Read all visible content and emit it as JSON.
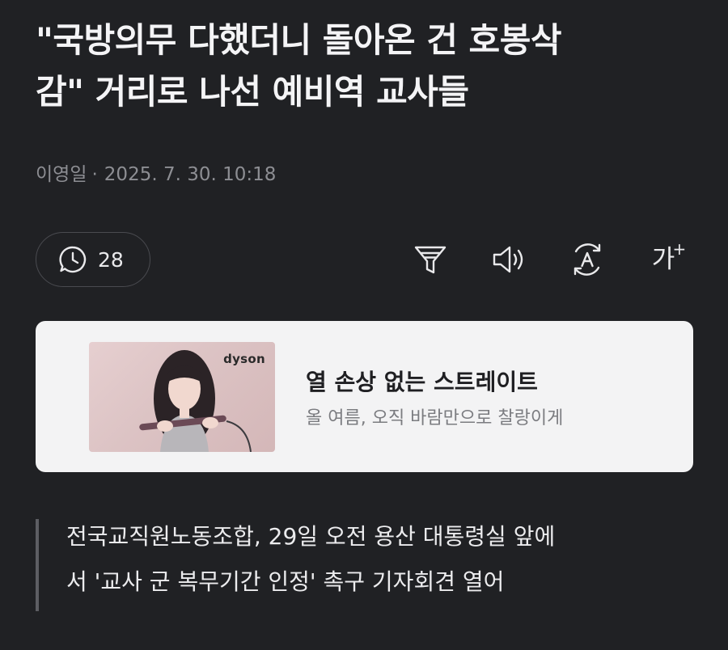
{
  "article": {
    "headline_line1": "\"국방의무 다했더니 돌아온 건 호봉삭",
    "headline_line2": "감\" 거리로 나선 예비역 교사들",
    "author": "이영일",
    "separator": "·",
    "datetime": "2025. 7. 30. 10:18",
    "summary_line1": "전국교직원노동조합, 29일 오전 용산 대통령실 앞에",
    "summary_line2": "서 '교사 군 복무기간 인정' 촉구 기자회견 열어"
  },
  "toolbar": {
    "comment_count": "28",
    "font_size_label": "가",
    "font_size_plus": "+",
    "icons": [
      "comment-clock-icon",
      "filter-icon",
      "speaker-icon",
      "translate-icon",
      "font-size-icon"
    ]
  },
  "ad": {
    "brand": "dyson",
    "title": "열 손상 없는 스트레이트",
    "subtitle": "올 여름, 오직 바람만으로 찰랑이게"
  },
  "colors": {
    "background": "#202124",
    "headline": "#f4f4f6",
    "meta": "#8d8e93",
    "card": "#f3f3f4"
  }
}
